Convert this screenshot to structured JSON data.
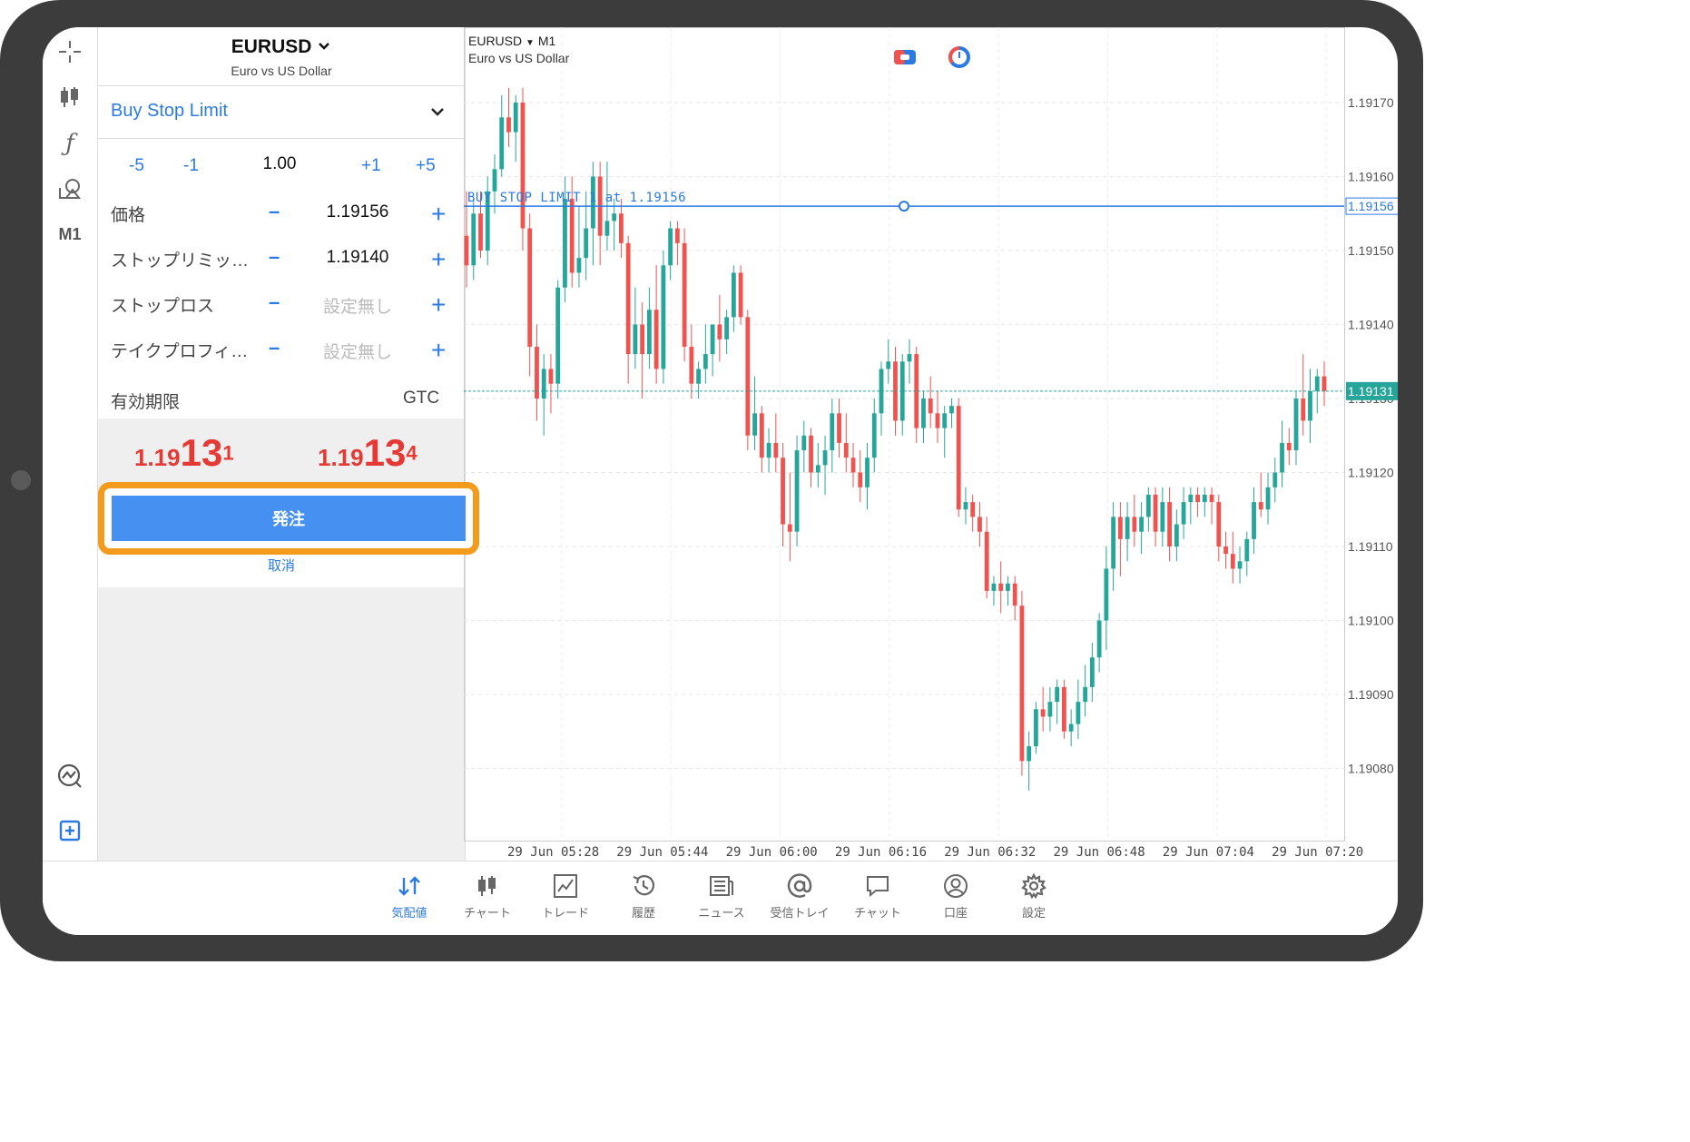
{
  "toolbar": {
    "items": [
      {
        "icon": "crosshair-icon"
      },
      {
        "icon": "candlestick-icon"
      },
      {
        "icon": "indicator-f-icon"
      },
      {
        "icon": "objects-icon"
      },
      {
        "icon": "timeframe",
        "label": "M1"
      },
      {
        "icon": "chart-analytics-icon"
      },
      {
        "icon": "new-order-icon"
      }
    ]
  },
  "panel": {
    "symbol": "EURUSD",
    "symbol_description": "Euro vs US Dollar",
    "order_type": "Buy Stop Limit",
    "volume": {
      "minus5": "-5",
      "minus1": "-1",
      "value": "1.00",
      "plus1": "+1",
      "plus5": "+5"
    },
    "rows": [
      {
        "label": "価格",
        "value": "1.19156"
      },
      {
        "label": "ストップリミッ…",
        "value": "1.19140"
      },
      {
        "label": "ストップロス",
        "value": "設定無し"
      },
      {
        "label": "テイクプロフィ…",
        "value": "設定無し"
      }
    ],
    "expiry_label": "有効期限",
    "expiry_value": "GTC",
    "bid": {
      "small": "1.19",
      "big": "13",
      "pip": "1"
    },
    "ask": {
      "small": "1.19",
      "big": "13",
      "pip": "4"
    },
    "order_button": "発注",
    "cancel": "取消"
  },
  "chart": {
    "symbol": "EURUSD",
    "timeframe": "M1",
    "description": "Euro vs US Dollar",
    "order_line_label": "BUY STOP LIMIT 1 at 1.19156",
    "order_line_price": "1.19156",
    "current_price": "1.19131",
    "price_axis": [
      "1.19170",
      "1.19160",
      "1.19150",
      "1.19140",
      "1.19130",
      "1.19120",
      "1.19110",
      "1.19100",
      "1.19090",
      "1.19080"
    ],
    "time_axis": [
      "29 Jun 05:28",
      "29 Jun 05:44",
      "29 Jun 06:00",
      "29 Jun 06:16",
      "29 Jun 06:32",
      "29 Jun 06:48",
      "29 Jun 07:04",
      "29 Jun 07:20"
    ],
    "colors": {
      "up": "#26a69a",
      "down": "#ef5350",
      "order_line": "#2a7ae2",
      "price_line": "#26a69a"
    },
    "candles": [
      [
        1.19152,
        1.19158,
        1.19145,
        1.19148
      ],
      [
        1.19148,
        1.19157,
        1.19146,
        1.19155
      ],
      [
        1.19155,
        1.19158,
        1.19149,
        1.1915
      ],
      [
        1.1915,
        1.1916,
        1.19148,
        1.19158
      ],
      [
        1.19158,
        1.19163,
        1.19155,
        1.19161
      ],
      [
        1.19161,
        1.19171,
        1.1916,
        1.19168
      ],
      [
        1.19168,
        1.19172,
        1.19164,
        1.19166
      ],
      [
        1.19166,
        1.19171,
        1.19162,
        1.1917
      ],
      [
        1.1917,
        1.19172,
        1.1915,
        1.19153
      ],
      [
        1.19153,
        1.19155,
        1.19133,
        1.19137
      ],
      [
        1.19137,
        1.1914,
        1.19127,
        1.1913
      ],
      [
        1.1913,
        1.19136,
        1.19125,
        1.19134
      ],
      [
        1.19134,
        1.19136,
        1.19128,
        1.19132
      ],
      [
        1.19132,
        1.19146,
        1.1913,
        1.19145
      ],
      [
        1.19145,
        1.1916,
        1.19143,
        1.19157
      ],
      [
        1.19157,
        1.1916,
        1.19145,
        1.19147
      ],
      [
        1.19147,
        1.19156,
        1.19145,
        1.19149
      ],
      [
        1.19149,
        1.19158,
        1.19146,
        1.19153
      ],
      [
        1.19153,
        1.19162,
        1.19148,
        1.1916
      ],
      [
        1.1916,
        1.19162,
        1.19148,
        1.19152
      ],
      [
        1.19152,
        1.19162,
        1.1915,
        1.19154
      ],
      [
        1.19154,
        1.19157,
        1.1915,
        1.19155
      ],
      [
        1.19155,
        1.19157,
        1.19149,
        1.19151
      ],
      [
        1.19151,
        1.19152,
        1.19132,
        1.19136
      ],
      [
        1.19136,
        1.19145,
        1.19134,
        1.1914
      ],
      [
        1.1914,
        1.19143,
        1.1913,
        1.19136
      ],
      [
        1.19136,
        1.19145,
        1.19134,
        1.19142
      ],
      [
        1.19142,
        1.19148,
        1.19132,
        1.19134
      ],
      [
        1.19134,
        1.1915,
        1.19132,
        1.19148
      ],
      [
        1.19148,
        1.19154,
        1.19146,
        1.19153
      ],
      [
        1.19153,
        1.19154,
        1.19148,
        1.19151
      ],
      [
        1.19151,
        1.19153,
        1.19135,
        1.19137
      ],
      [
        1.19137,
        1.1914,
        1.1913,
        1.19132
      ],
      [
        1.19132,
        1.19135,
        1.1913,
        1.19134
      ],
      [
        1.19134,
        1.1914,
        1.19132,
        1.19136
      ],
      [
        1.19136,
        1.1914,
        1.19133,
        1.1914
      ],
      [
        1.1914,
        1.19144,
        1.19135,
        1.19138
      ],
      [
        1.19138,
        1.19142,
        1.19136,
        1.19141
      ],
      [
        1.19141,
        1.19148,
        1.19139,
        1.19147
      ],
      [
        1.19147,
        1.19148,
        1.1914,
        1.19141
      ],
      [
        1.19141,
        1.19142,
        1.19123,
        1.19125
      ],
      [
        1.19125,
        1.19133,
        1.19123,
        1.19128
      ],
      [
        1.19128,
        1.19129,
        1.1912,
        1.19122
      ],
      [
        1.19122,
        1.19126,
        1.1912,
        1.19124
      ],
      [
        1.19124,
        1.19128,
        1.1912,
        1.19122
      ],
      [
        1.19122,
        1.19124,
        1.1911,
        1.19113
      ],
      [
        1.19113,
        1.1912,
        1.19108,
        1.19112
      ],
      [
        1.19112,
        1.19125,
        1.1911,
        1.19123
      ],
      [
        1.19123,
        1.19127,
        1.1912,
        1.19125
      ],
      [
        1.19125,
        1.19126,
        1.19118,
        1.1912
      ],
      [
        1.1912,
        1.19124,
        1.19118,
        1.19121
      ],
      [
        1.19121,
        1.19125,
        1.19117,
        1.19123
      ],
      [
        1.19123,
        1.1913,
        1.1912,
        1.19128
      ],
      [
        1.19128,
        1.1913,
        1.19122,
        1.19124
      ],
      [
        1.19124,
        1.19128,
        1.1912,
        1.19122
      ],
      [
        1.19122,
        1.19124,
        1.19118,
        1.1912
      ],
      [
        1.1912,
        1.19123,
        1.19116,
        1.19118
      ],
      [
        1.19118,
        1.19124,
        1.19115,
        1.19122
      ],
      [
        1.19122,
        1.1913,
        1.1912,
        1.19128
      ],
      [
        1.19128,
        1.19135,
        1.19125,
        1.19134
      ],
      [
        1.19134,
        1.19138,
        1.19132,
        1.19135
      ],
      [
        1.19135,
        1.19137,
        1.19125,
        1.19127
      ],
      [
        1.19127,
        1.19136,
        1.19125,
        1.19135
      ],
      [
        1.19135,
        1.19138,
        1.19132,
        1.19136
      ],
      [
        1.19136,
        1.19137,
        1.19124,
        1.19126
      ],
      [
        1.19126,
        1.19131,
        1.19124,
        1.1913
      ],
      [
        1.1913,
        1.19133,
        1.19126,
        1.19128
      ],
      [
        1.19128,
        1.19131,
        1.19124,
        1.19126
      ],
      [
        1.19126,
        1.19129,
        1.19122,
        1.19128
      ],
      [
        1.19128,
        1.1913,
        1.19126,
        1.19129
      ],
      [
        1.19129,
        1.1913,
        1.19114,
        1.19115
      ],
      [
        1.19115,
        1.19118,
        1.19113,
        1.19116
      ],
      [
        1.19116,
        1.19117,
        1.19112,
        1.19114
      ],
      [
        1.19114,
        1.19116,
        1.1911,
        1.19112
      ],
      [
        1.19112,
        1.19114,
        1.19103,
        1.19104
      ],
      [
        1.19104,
        1.19106,
        1.19102,
        1.19105
      ],
      [
        1.19105,
        1.19108,
        1.19101,
        1.19104
      ],
      [
        1.19104,
        1.19106,
        1.19102,
        1.19105
      ],
      [
        1.19105,
        1.19106,
        1.191,
        1.19102
      ],
      [
        1.19102,
        1.19104,
        1.19079,
        1.19081
      ],
      [
        1.19081,
        1.19085,
        1.19077,
        1.19083
      ],
      [
        1.19083,
        1.19089,
        1.19082,
        1.19088
      ],
      [
        1.19088,
        1.19091,
        1.19085,
        1.19087
      ],
      [
        1.19087,
        1.19091,
        1.19085,
        1.19089
      ],
      [
        1.19089,
        1.19092,
        1.19086,
        1.19091
      ],
      [
        1.19091,
        1.19092,
        1.19084,
        1.19085
      ],
      [
        1.19085,
        1.19088,
        1.19083,
        1.19086
      ],
      [
        1.19086,
        1.19092,
        1.19084,
        1.19089
      ],
      [
        1.19089,
        1.19094,
        1.19087,
        1.19091
      ],
      [
        1.19091,
        1.19097,
        1.19089,
        1.19095
      ],
      [
        1.19095,
        1.19101,
        1.19093,
        1.191
      ],
      [
        1.191,
        1.1911,
        1.19096,
        1.19107
      ],
      [
        1.19107,
        1.19116,
        1.19104,
        1.19114
      ],
      [
        1.19114,
        1.19116,
        1.19106,
        1.19111
      ],
      [
        1.19111,
        1.19116,
        1.19108,
        1.19114
      ],
      [
        1.19114,
        1.19117,
        1.1911,
        1.19112
      ],
      [
        1.19112,
        1.19116,
        1.19109,
        1.19114
      ],
      [
        1.19114,
        1.19118,
        1.19112,
        1.19117
      ],
      [
        1.19117,
        1.19118,
        1.1911,
        1.19112
      ],
      [
        1.19112,
        1.19118,
        1.1911,
        1.19116
      ],
      [
        1.19116,
        1.19118,
        1.19108,
        1.1911
      ],
      [
        1.1911,
        1.19115,
        1.19108,
        1.19113
      ],
      [
        1.19113,
        1.19118,
        1.19111,
        1.19116
      ],
      [
        1.19116,
        1.19118,
        1.19113,
        1.19117
      ],
      [
        1.19117,
        1.19118,
        1.19114,
        1.19116
      ],
      [
        1.19116,
        1.19118,
        1.19114,
        1.19117
      ],
      [
        1.19117,
        1.19118,
        1.19113,
        1.19116
      ],
      [
        1.19116,
        1.19117,
        1.19108,
        1.1911
      ],
      [
        1.1911,
        1.19112,
        1.19107,
        1.19109
      ],
      [
        1.19109,
        1.19112,
        1.19105,
        1.19107
      ],
      [
        1.19107,
        1.1911,
        1.19105,
        1.19108
      ],
      [
        1.19108,
        1.19112,
        1.19106,
        1.19111
      ],
      [
        1.19111,
        1.19118,
        1.19109,
        1.19116
      ],
      [
        1.19116,
        1.1912,
        1.19114,
        1.19115
      ],
      [
        1.19115,
        1.1912,
        1.19113,
        1.19118
      ],
      [
        1.19118,
        1.19122,
        1.19116,
        1.1912
      ],
      [
        1.1912,
        1.19127,
        1.19118,
        1.19124
      ],
      [
        1.19124,
        1.19126,
        1.19121,
        1.19123
      ],
      [
        1.19123,
        1.19131,
        1.19121,
        1.1913
      ],
      [
        1.1913,
        1.19136,
        1.19125,
        1.19127
      ],
      [
        1.19127,
        1.19134,
        1.19124,
        1.19131
      ],
      [
        1.19131,
        1.19134,
        1.19128,
        1.19133
      ],
      [
        1.19133,
        1.19135,
        1.19129,
        1.19131
      ]
    ]
  },
  "bottom_nav": [
    {
      "label": "気配値",
      "icon": "quotes-icon",
      "active": true
    },
    {
      "label": "チャート",
      "icon": "chart-icon",
      "active": false
    },
    {
      "label": "トレード",
      "icon": "trade-icon",
      "active": false
    },
    {
      "label": "履歴",
      "icon": "history-icon",
      "active": false
    },
    {
      "label": "ニュース",
      "icon": "news-icon",
      "active": false
    },
    {
      "label": "受信トレイ",
      "icon": "mail-icon",
      "active": false
    },
    {
      "label": "チャット",
      "icon": "chat-icon",
      "active": false
    },
    {
      "label": "口座",
      "icon": "account-icon",
      "active": false
    },
    {
      "label": "設定",
      "icon": "settings-icon",
      "active": false
    }
  ]
}
